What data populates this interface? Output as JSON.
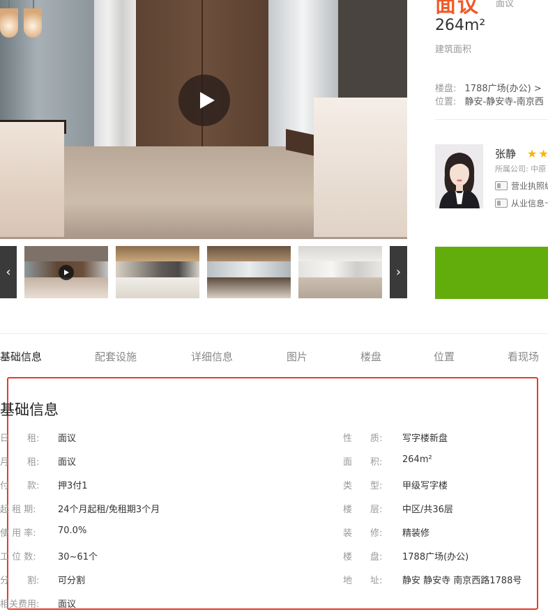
{
  "gallery": {
    "thumbnail_count": 4
  },
  "summary": {
    "price_fragment": "面议",
    "price_unit_fragment": "面议",
    "area_value": "264m²",
    "area_label": "建筑面积",
    "building_label": "楼盘:",
    "building_value": "1788广场(办公) >",
    "location_label": "位置:",
    "location_value": "静安-静安寺-南京西"
  },
  "agent": {
    "name": "张静",
    "company_label": "所属公司: 中原",
    "cert_business": "营业执照编",
    "cert_practice": "从业信息卡"
  },
  "tabs": [
    {
      "label": "基础信息",
      "active": true
    },
    {
      "label": "配套设施",
      "active": false
    },
    {
      "label": "详细信息",
      "active": false
    },
    {
      "label": "图片",
      "active": false
    },
    {
      "label": "楼盘",
      "active": false
    },
    {
      "label": "位置",
      "active": false
    },
    {
      "label": "看现场",
      "active": false
    }
  ],
  "basic_info": {
    "title": "基础信息",
    "left_rows": [
      {
        "label": "日　　租:",
        "value": "面议"
      },
      {
        "label": "月　　租:",
        "value": "面议"
      },
      {
        "label": "付　　款:",
        "value": "押3付1"
      },
      {
        "label": "起 租 期:",
        "value": "24个月起租/免租期3个月"
      },
      {
        "label": "使 用 率:",
        "value": "70.0%"
      },
      {
        "label": "工 位 数:",
        "value": "30~61个"
      },
      {
        "label": "分　　割:",
        "value": "可分割"
      },
      {
        "label": "相关费用:",
        "value": "面议"
      }
    ],
    "right_rows": [
      {
        "label": "性　　质:",
        "value": "写字楼新盘"
      },
      {
        "label": "面　　积:",
        "value": "264m²"
      },
      {
        "label": "类　　型:",
        "value": "甲级写字楼"
      },
      {
        "label": "楼　　层:",
        "value": "中区/共36层"
      },
      {
        "label": "装　　修:",
        "value": "精装修"
      },
      {
        "label": "楼　　盘:",
        "value": "1788广场(办公)"
      },
      {
        "label": "地　　址:",
        "value": "静安 静安寺 南京西路1788号"
      }
    ]
  },
  "colors": {
    "accent_orange": "#f05a28",
    "contact_green": "#62ad0c",
    "highlight_red": "#e53a2c",
    "star_yellow": "#f7b500"
  },
  "icons": [
    "play-icon",
    "chevron-left-icon",
    "chevron-right-icon",
    "star-icon",
    "business-license-icon",
    "practice-card-icon"
  ]
}
